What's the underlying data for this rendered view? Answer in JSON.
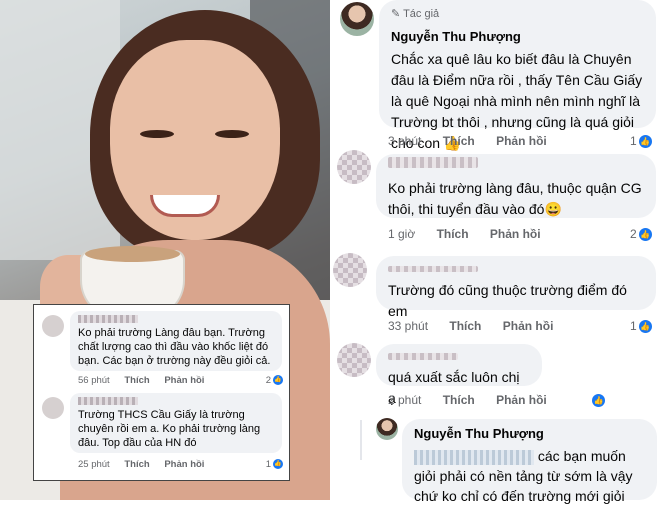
{
  "overlay": {
    "comments": [
      {
        "text": "Ko phải trường Làng đâu bạn. Trường chất lượng cao thì đầu vào khốc liệt đó bạn. Các bạn ở trường này đều giỏi cả.",
        "time": "56 phút",
        "like": "Thích",
        "reply": "Phản hồi",
        "reactions": "2"
      },
      {
        "text": "Trường THCS Cầu Giấy là trường chuyên rồi em a. Ko phải trường làng đâu. Top đầu của HN đó",
        "time": "25 phút",
        "like": "Thích",
        "reply": "Phản hồi",
        "reactions": "1"
      }
    ]
  },
  "thread": {
    "comments": [
      {
        "badge": "Tác giả",
        "author": "Nguyễn Thu Phượng",
        "text": "Chắc xa quê lâu ko biết đâu là Chuyên đâu là Điểm nữa rồi , thấy Tên Cầu Giấy là quê Ngoại nhà mình nên mình nghĩ là Trường bt thôi , nhưng cũng là quá giỏi cho con 👍",
        "time": "3 phút",
        "like": "Thích",
        "reply": "Phản hồi",
        "reactions": "1"
      },
      {
        "author": "Nguyễn Trang",
        "text": "Ko phải trường làng đâu, thuộc quận CG thôi, thi tuyển đầu vào đó😀",
        "time": "1 giờ",
        "like": "Thích",
        "reply": "Phản hồi",
        "reactions": "2"
      },
      {
        "text": "Trường đó cũng thuộc trường điểm đó em",
        "time": "33 phút",
        "like": "Thích",
        "reply": "Phản hồi",
        "reactions": "1"
      },
      {
        "text": "quá xuất sắc luôn chị ạ",
        "time": "2 phút",
        "like": "Thích",
        "reply": "Phản hồi"
      },
      {
        "author": "Nguyễn Thu Phượng",
        "text_after_tag": "các bạn muốn giỏi phải có nền tảng từ sớm là vậy chứ ko chỉ có đến trường mới giỏi"
      }
    ]
  },
  "colors": {
    "bubble": "#f0f2f5",
    "meta": "#65676b",
    "like_blue": "#1877f2"
  }
}
